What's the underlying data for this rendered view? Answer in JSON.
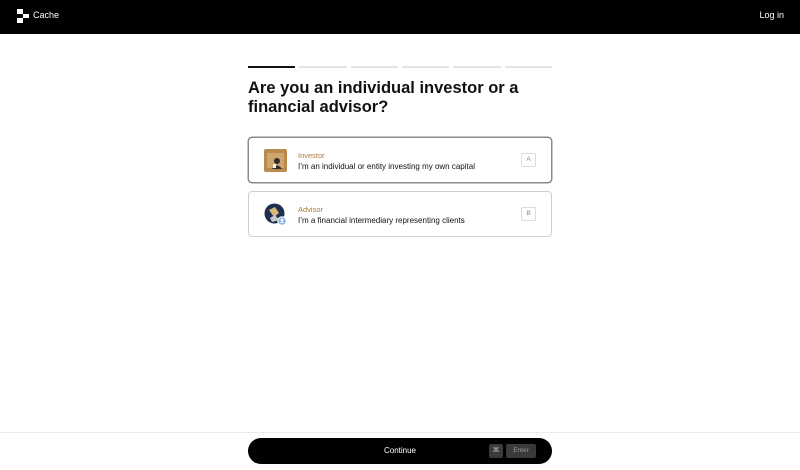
{
  "header": {
    "brand": "Cache",
    "login_label": "Log in"
  },
  "progress": {
    "total_steps": 6,
    "current_step": 1
  },
  "question": "Are you an individual investor or a financial advisor?",
  "options": [
    {
      "title": "Investor",
      "description": "I’m an individual or entity investing my own capital",
      "key": "A",
      "selected": true
    },
    {
      "title": "Advisor",
      "description": "I’m a financial intermediary representing clients",
      "key": "B",
      "selected": false
    }
  ],
  "footer": {
    "continue_label": "Continue",
    "shortcut_cmd": "⌘",
    "shortcut_enter": "Enter"
  },
  "colors": {
    "accent_label": "#a97a3a",
    "primary_button": "#000000"
  }
}
